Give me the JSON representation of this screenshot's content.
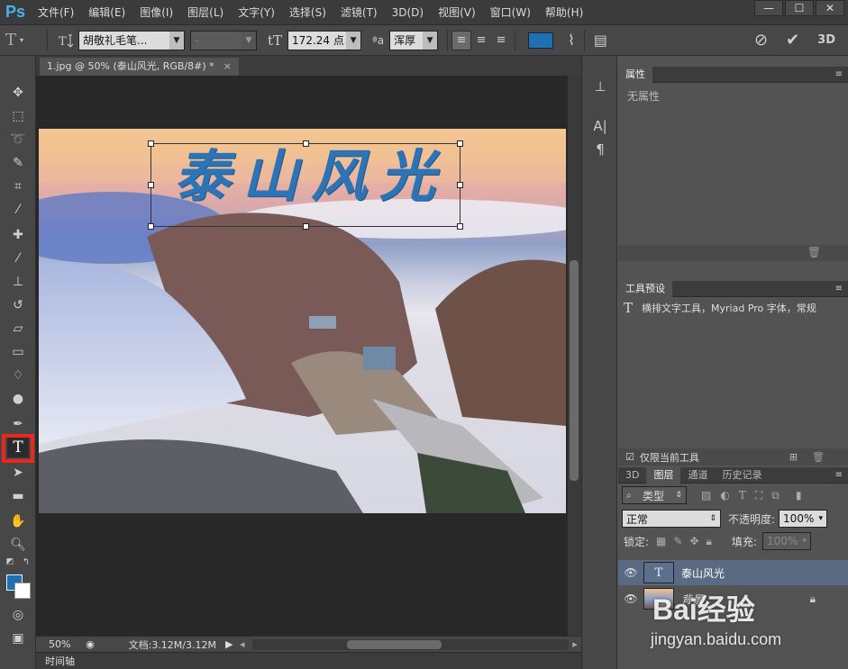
{
  "app": {
    "logo": "Ps"
  },
  "menu": [
    "文件(F)",
    "编辑(E)",
    "图像(I)",
    "图层(L)",
    "文字(Y)",
    "选择(S)",
    "滤镜(T)",
    "3D(D)",
    "视图(V)",
    "窗口(W)",
    "帮助(H)"
  ],
  "options": {
    "font_family": "胡敬礼毛笔...",
    "font_style": "-",
    "font_size": "172.24 点",
    "aa_label": "ªa",
    "antialias": "浑厚",
    "text_color": "#1d6fb8",
    "threed_label": "3D"
  },
  "document": {
    "tab_title": "1.jpg @ 50% (泰山风光, RGB/8#) *",
    "tab_close": "×",
    "canvas_text": "泰山风光",
    "zoom": "50%",
    "doc_size": "文档:3.12M/3.12M"
  },
  "timeline": {
    "label": "时间轴"
  },
  "properties": {
    "title": "属性",
    "content": "无属性"
  },
  "tool_presets": {
    "title": "工具预设",
    "item": "横排文字工具，Myriad Pro 字体，常规",
    "checkbox_label": "仅限当前工具"
  },
  "layers_panel": {
    "tabs": [
      "3D",
      "图层",
      "通道",
      "历史记录"
    ],
    "filter_label": "类型",
    "blend_mode": "正常",
    "opacity_label": "不透明度:",
    "opacity_value": "100%",
    "lock_label": "锁定:",
    "fill_label": "填充:",
    "fill_value": "100%",
    "layers": [
      {
        "name": "泰山风光",
        "type": "text"
      },
      {
        "name": "背景",
        "type": "image"
      }
    ]
  },
  "watermark": {
    "brand": "Bai经验",
    "url": "jingyan.baidu.com"
  },
  "colors": {
    "foreground": "#1d6fb8",
    "background": "#ffffff",
    "highlight": "#e8271e"
  }
}
